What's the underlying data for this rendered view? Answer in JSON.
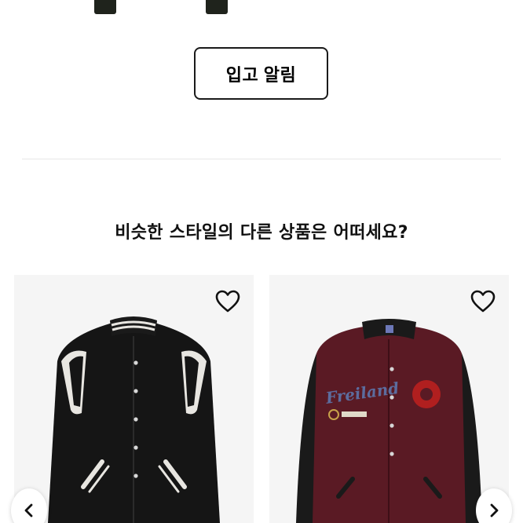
{
  "actions": {
    "notify_label": "입고 알림"
  },
  "recommendations": {
    "title": "비슷한 스타일의 다른 상품은 어떠세요?",
    "products": [
      {
        "name": "black-white varsity jacket",
        "colors": {
          "body": "#151515",
          "stripe": "#e8e6e1"
        }
      },
      {
        "name": "burgundy varsity jacket",
        "colors": {
          "body": "#5a1a24",
          "sleeve": "#1a1a1a"
        },
        "patch_text": "Freiland"
      }
    ]
  }
}
